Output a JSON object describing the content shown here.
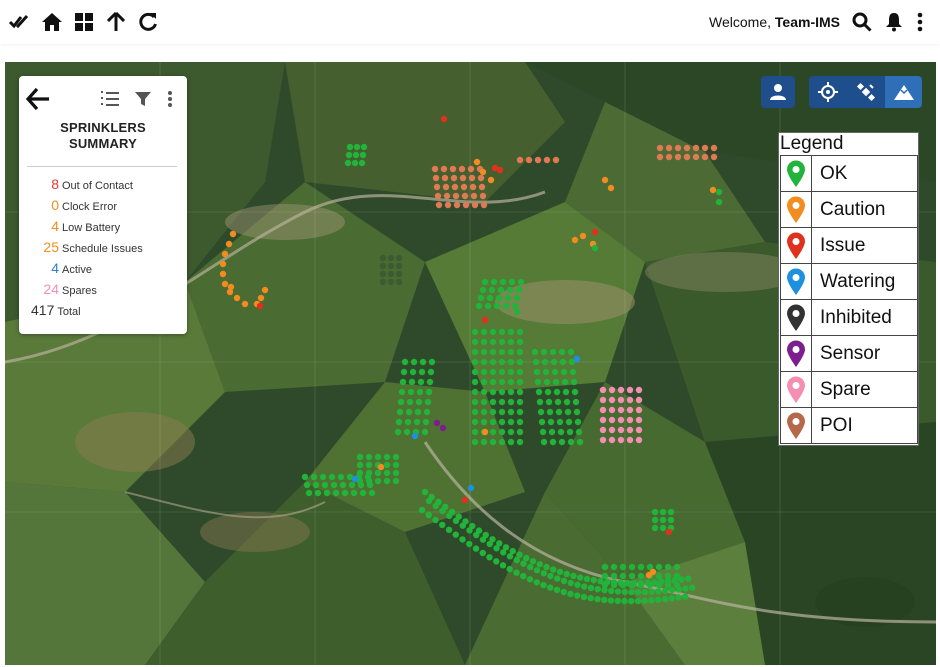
{
  "header": {
    "welcome_prefix": "Welcome, ",
    "user_name": "Team-IMS",
    "icons": [
      "double-check-icon",
      "home-icon",
      "grid-icon",
      "arrow-up-icon",
      "refresh-icon",
      "search-icon",
      "bell-icon",
      "more-vertical-icon"
    ]
  },
  "summary": {
    "title_line1": "SPRINKLERS",
    "title_line2": "SUMMARY",
    "stats": [
      {
        "value": "8",
        "label": "Out of Contact",
        "color": "#e53935"
      },
      {
        "value": "0",
        "label": "Clock Error",
        "color": "#f28c1f"
      },
      {
        "value": "4",
        "label": "Low Battery",
        "color": "#f28c1f"
      },
      {
        "value": "25",
        "label": "Schedule Issues",
        "color": "#f28c1f"
      },
      {
        "value": "4",
        "label": "Active",
        "color": "#2f7fc1"
      },
      {
        "value": "24",
        "label": "Spares",
        "color": "#f48fb1"
      },
      {
        "value": "417",
        "label": "Total",
        "color": "#333333"
      }
    ]
  },
  "legend": {
    "title": "Legend",
    "items": [
      {
        "label": "OK",
        "color": "#22b33a"
      },
      {
        "label": "Caution",
        "color": "#f28c1f"
      },
      {
        "label": "Issue",
        "color": "#e0301e"
      },
      {
        "label": "Watering",
        "color": "#1e90e0"
      },
      {
        "label": "Inhibited",
        "color": "#333333"
      },
      {
        "label": "Sensor",
        "color": "#7b1f8c"
      },
      {
        "label": "Spare",
        "color": "#f48fb1"
      },
      {
        "label": "POI",
        "color": "#b5694a"
      }
    ]
  },
  "map_controls": [
    "user-icon",
    "crosshair-icon",
    "satellite-icon",
    "terrain-icon"
  ]
}
